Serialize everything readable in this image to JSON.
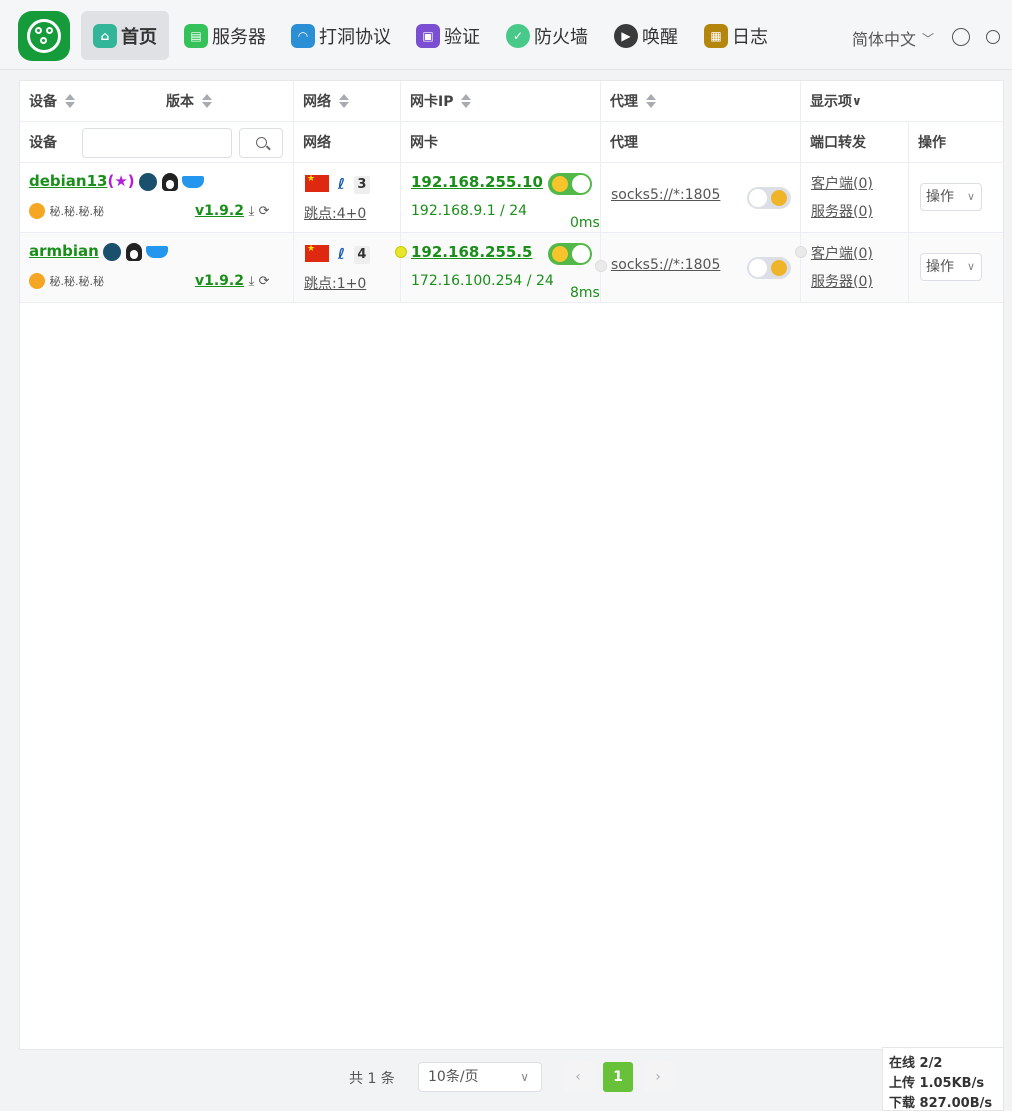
{
  "nav": {
    "items": [
      {
        "label": "首页",
        "icon": "home-icon",
        "color": "#33b59a",
        "active": true
      },
      {
        "label": "服务器",
        "icon": "server-icon",
        "color": "#36c25b"
      },
      {
        "label": "打洞协议",
        "icon": "tunnel-icon",
        "color": "#2b8fd6"
      },
      {
        "label": "验证",
        "icon": "lock-icon",
        "color": "#7a4fd1"
      },
      {
        "label": "防火墙",
        "icon": "shield-icon",
        "color": "#48c989"
      },
      {
        "label": "唤醒",
        "icon": "play-icon",
        "color": "#3a3a3a"
      },
      {
        "label": "日志",
        "icon": "log-icon",
        "color": "#b5860e"
      }
    ],
    "language": "简体中文"
  },
  "table": {
    "headers": {
      "device": "设备",
      "version": "版本",
      "network": "网络",
      "nic_ip": "网卡IP",
      "proxy": "代理",
      "display": "显示项"
    },
    "subheaders": {
      "device": "设备",
      "network": "网络",
      "nic": "网卡",
      "proxy": "代理",
      "port_forward": "端口转发",
      "actions": "操作"
    },
    "search_placeholder": "",
    "rows": [
      {
        "name": "debian13",
        "star": "(★)",
        "secrets": "秘.秘.秘.秘",
        "version": "v1.9.2",
        "net_count": "3",
        "hops": "跳点:4+0",
        "ip": "192.168.255.10",
        "lan": "192.168.9.1 / 24",
        "latency": "0ms",
        "proxy": "socks5://*:1805",
        "client": "客户端(0)",
        "server": "服务器(0)",
        "action": "操作"
      },
      {
        "name": "armbian",
        "secrets": "秘.秘.秘.秘",
        "version": "v1.9.2",
        "net_count": "4",
        "hops": "跳点:1+0",
        "ip": "192.168.255.5",
        "lan": "172.16.100.254 / 24",
        "latency": "8ms",
        "proxy": "socks5://*:1805",
        "client": "客户端(0)",
        "server": "服务器(0)",
        "action": "操作"
      }
    ]
  },
  "pagination": {
    "total": "共 1 条",
    "page_size": "10条/页",
    "prev": "‹",
    "current": "1",
    "next": "›"
  },
  "stats": {
    "online": "在线 2/2",
    "upload": "上传 1.05KB/s",
    "download": "下载 827.00B/s"
  }
}
